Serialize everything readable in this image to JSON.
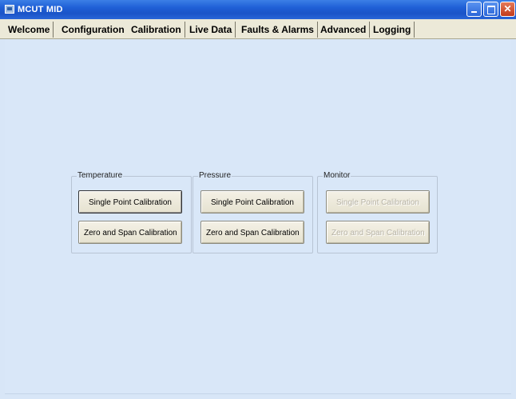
{
  "window": {
    "title": "MCUT MID"
  },
  "tabs": [
    {
      "label": "Welcome"
    },
    {
      "label": "Configuration"
    },
    {
      "label": "Calibration"
    },
    {
      "label": "Live Data"
    },
    {
      "label": "Faults & Alarms"
    },
    {
      "label": "Advanced"
    },
    {
      "label": "Logging"
    }
  ],
  "active_tab": "Calibration",
  "groups": {
    "temperature": {
      "label": "Temperature",
      "single_point": "Single Point Calibration",
      "zero_span": "Zero and Span Calibration"
    },
    "pressure": {
      "label": "Pressure",
      "single_point": "Single Point Calibration",
      "zero_span": "Zero and Span Calibration"
    },
    "monitor": {
      "label": "Monitor",
      "single_point": "Single Point Calibration",
      "zero_span": "Zero and Span Calibration",
      "enabled": false
    }
  }
}
